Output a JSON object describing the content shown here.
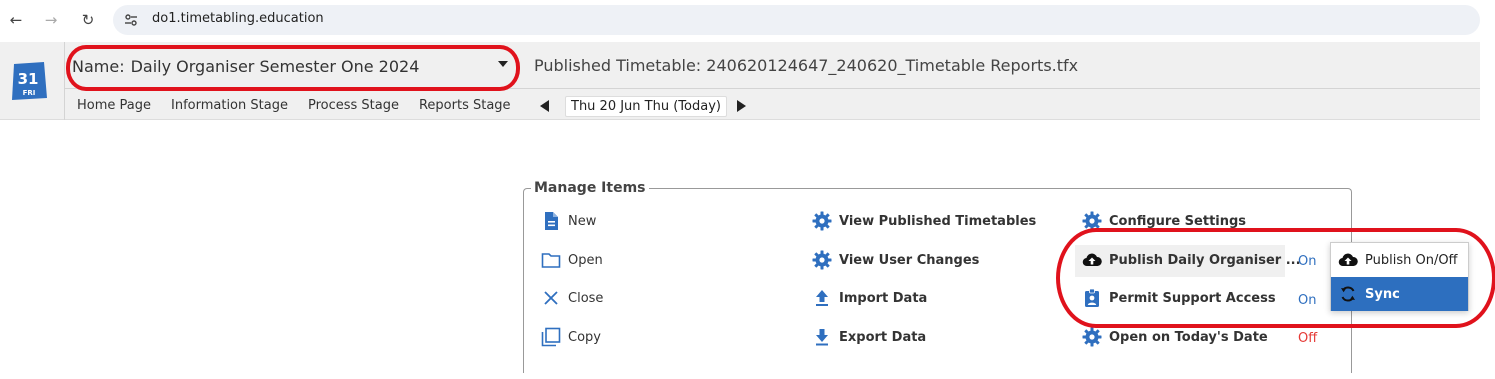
{
  "browser": {
    "url": "do1.timetabling.education"
  },
  "logo": {
    "day_number": "31",
    "day_label": "FRI"
  },
  "header": {
    "name_prefix": "Name:",
    "name_value": "Daily Organiser Semester One 2024",
    "published_title": "Published Timetable: 240620124647_240620_Timetable Reports.tfx"
  },
  "tabs": [
    {
      "label": "Home Page"
    },
    {
      "label": "Information Stage"
    },
    {
      "label": "Process Stage"
    },
    {
      "label": "Reports Stage"
    }
  ],
  "date_nav": {
    "current": "Thu 20 Jun Thu (Today)"
  },
  "manage": {
    "legend": "Manage Items",
    "col1": [
      {
        "label": "New",
        "icon": "document-icon"
      },
      {
        "label": "Open",
        "icon": "folder-icon"
      },
      {
        "label": "Close",
        "icon": "close-icon"
      },
      {
        "label": "Copy",
        "icon": "copy-icon"
      }
    ],
    "col2": [
      {
        "label": "View Published Timetables",
        "icon": "gear-icon"
      },
      {
        "label": "View User Changes",
        "icon": "gear-icon"
      },
      {
        "label": "Import Data",
        "icon": "upload-icon"
      },
      {
        "label": "Export Data",
        "icon": "download-icon"
      }
    ],
    "col3": [
      {
        "label": "Configure Settings",
        "icon": "gear-icon",
        "state": ""
      },
      {
        "label": "Publish Daily Organiser ...",
        "icon": "cloud-upload-icon",
        "state": "On"
      },
      {
        "label": "Permit Support Access",
        "icon": "badge-icon",
        "state": "On"
      },
      {
        "label": "Open on Today's Date",
        "icon": "gear-icon",
        "state": "Off"
      }
    ]
  },
  "popup": {
    "items": [
      {
        "label": "Publish On/Off",
        "icon": "cloud-upload-icon"
      },
      {
        "label": "Sync",
        "icon": "sync-icon"
      }
    ]
  },
  "colors": {
    "accent_blue": "#2d6fbf",
    "icon_blue": "#2f6fbf",
    "state_on": "#2f6fbf",
    "state_off": "#e53935",
    "annotation_red": "#e0121c"
  }
}
